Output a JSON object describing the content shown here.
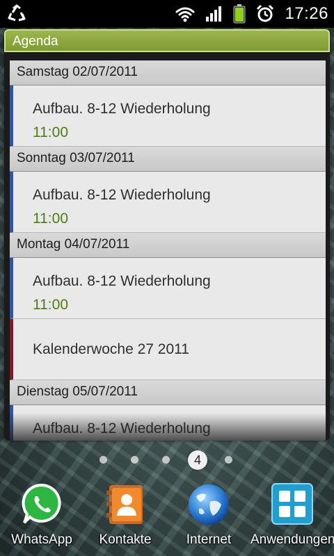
{
  "status_bar": {
    "time": "17:26",
    "icons": [
      "recycle-icon",
      "wifi-icon",
      "signal-icon",
      "battery-icon",
      "alarm-icon"
    ]
  },
  "widget": {
    "title": "Agenda",
    "days": [
      {
        "date": "Samstag 02/07/2011",
        "events": [
          {
            "title": "Aufbau.  8-12 Wiederholung",
            "time": "11:00"
          }
        ]
      },
      {
        "date": "Sonntag 03/07/2011",
        "events": [
          {
            "title": "Aufbau.  8-12 Wiederholung",
            "time": "11:00"
          }
        ]
      },
      {
        "date": "Montag 04/07/2011",
        "events": [
          {
            "title": "Aufbau.  8-12 Wiederholung",
            "time": "11:00"
          },
          {
            "title": "Kalenderwoche 27 2011"
          }
        ]
      },
      {
        "date": "Dienstag 05/07/2011",
        "events": [
          {
            "title": "Aufbau.  8-12 Wiederholung"
          }
        ]
      }
    ]
  },
  "pager": {
    "current_page": "4"
  },
  "dock": {
    "items": [
      {
        "label": "WhatsApp",
        "icon": "whatsapp-icon"
      },
      {
        "label": "Kontakte",
        "icon": "contacts-icon"
      },
      {
        "label": "Internet",
        "icon": "globe-icon"
      },
      {
        "label": "Anwendungen",
        "icon": "apps-grid-icon"
      }
    ]
  },
  "colors": {
    "header_green": "#8aa83d",
    "event_bar_blue": "#2f57a0",
    "week_bar_red": "#7a1d2a",
    "time_green": "#4e7b12"
  }
}
